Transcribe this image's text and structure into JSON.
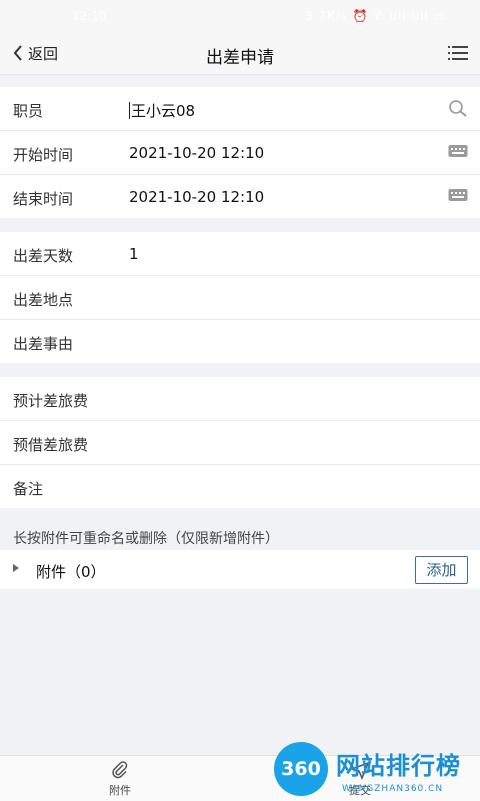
{
  "statusbar": {
    "time": "12:10",
    "icons_text": "3.7K/s ⏰ ✆ ull ull ▭"
  },
  "nav": {
    "back_label": "返回",
    "title": "出差申请"
  },
  "groups": [
    {
      "rows": [
        {
          "label": "职员",
          "value": "王小云08",
          "icon": "search-icon"
        },
        {
          "label": "开始时间",
          "value": "2021-10-20 12:10",
          "icon": "keyboard-icon"
        },
        {
          "label": "结束时间",
          "value": "2021-10-20 12:10",
          "icon": "keyboard-icon"
        }
      ]
    },
    {
      "rows": [
        {
          "label": "出差天数",
          "value": "1"
        },
        {
          "label": "出差地点",
          "value": ""
        },
        {
          "label": "出差事由",
          "value": ""
        }
      ]
    },
    {
      "rows": [
        {
          "label": "预计差旅费",
          "value": ""
        },
        {
          "label": "预借差旅费",
          "value": ""
        },
        {
          "label": "备注",
          "value": ""
        }
      ]
    }
  ],
  "attachments": {
    "hint": "长按附件可重命名或删除（仅限新增附件）",
    "label": "附件（0）",
    "add_label": "添加"
  },
  "tabbar": {
    "attach_label": "附件",
    "submit_label": "提交"
  },
  "watermark": {
    "badge": "360",
    "text": "网站排行榜",
    "url": "WANGZHAN360.CN"
  }
}
